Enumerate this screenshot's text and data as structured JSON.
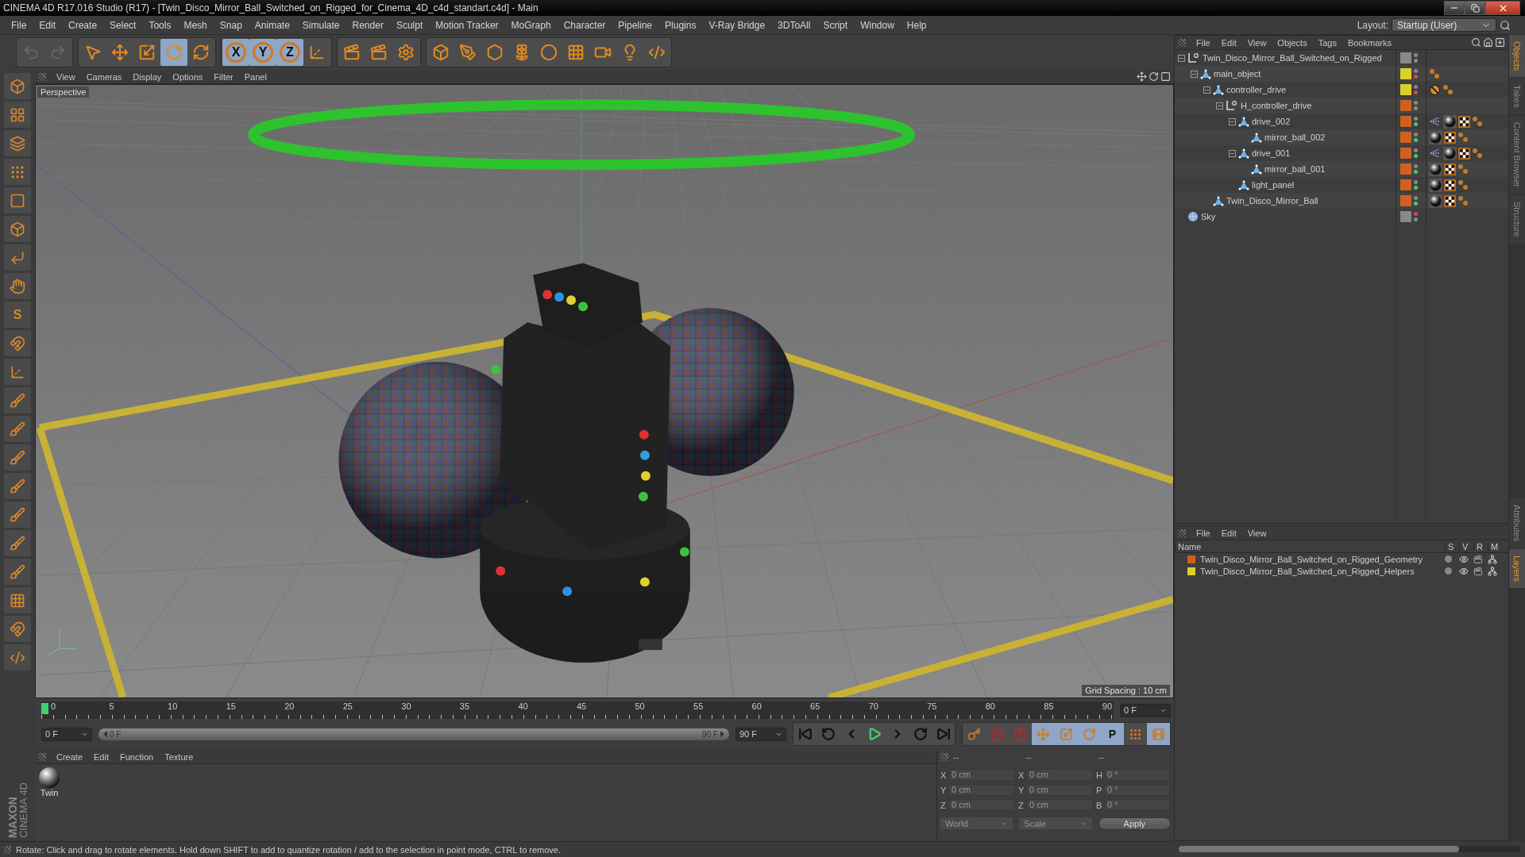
{
  "window": {
    "title": "CINEMA 4D R17.016 Studio (R17) - [Twin_Disco_Mirror_Ball_Switched_on_Rigged_for_Cinema_4D_c4d_standart.c4d] - Main"
  },
  "menu_bar": [
    "File",
    "Edit",
    "Create",
    "Select",
    "Tools",
    "Mesh",
    "Snap",
    "Animate",
    "Simulate",
    "Render",
    "Sculpt",
    "Motion Tracker",
    "MoGraph",
    "Character",
    "Pipeline",
    "Plugins",
    "V-Ray Bridge",
    "3DToAll",
    "Script",
    "Window",
    "Help"
  ],
  "layout": {
    "label": "Layout:",
    "value": "Startup (User)"
  },
  "toolbar": [
    {
      "kind": "undo",
      "selected": false,
      "disabled": true
    },
    {
      "kind": "redo",
      "selected": false,
      "disabled": true
    },
    {
      "kind": "select",
      "selected": false,
      "disabled": false
    },
    {
      "kind": "move",
      "selected": false,
      "disabled": false
    },
    {
      "kind": "scale",
      "selected": false,
      "disabled": false
    },
    {
      "kind": "rotate",
      "selected": true,
      "disabled": false
    },
    {
      "kind": "recent",
      "selected": false,
      "disabled": false
    },
    {
      "kind": "axis",
      "label": "X",
      "selected": true,
      "disabled": false
    },
    {
      "kind": "axis",
      "label": "Y",
      "selected": true,
      "disabled": false
    },
    {
      "kind": "axis",
      "label": "Z",
      "selected": true,
      "disabled": false
    },
    {
      "kind": "coords",
      "selected": false,
      "disabled": false
    },
    {
      "kind": "render",
      "selected": false,
      "disabled": false
    },
    {
      "kind": "render-view",
      "selected": false,
      "disabled": false
    },
    {
      "kind": "render-settings",
      "selected": false,
      "disabled": false
    },
    {
      "kind": "cube",
      "selected": false,
      "disabled": false
    },
    {
      "kind": "pen",
      "selected": false,
      "disabled": false
    },
    {
      "kind": "subdivide",
      "selected": false,
      "disabled": false
    },
    {
      "kind": "cloner",
      "selected": false,
      "disabled": false
    },
    {
      "kind": "deformer",
      "selected": false,
      "disabled": false
    },
    {
      "kind": "floor",
      "selected": false,
      "disabled": false
    },
    {
      "kind": "camera",
      "selected": false,
      "disabled": false
    },
    {
      "kind": "light",
      "selected": false,
      "disabled": false
    },
    {
      "kind": "python",
      "selected": false,
      "disabled": false
    }
  ],
  "left_tools": [
    {
      "kind": "cube",
      "selected": false
    },
    {
      "kind": "texture",
      "selected": false
    },
    {
      "kind": "layers",
      "selected": false
    },
    {
      "kind": "points",
      "selected": false
    },
    {
      "kind": "edges",
      "selected": false
    },
    {
      "kind": "polygons",
      "selected": false
    },
    {
      "kind": "angle",
      "selected": false
    },
    {
      "kind": "hand",
      "selected": false
    },
    {
      "kind": "letter",
      "label": "S",
      "selected": false
    },
    {
      "kind": "magnet",
      "selected": false
    },
    {
      "kind": "axis",
      "selected": false
    },
    {
      "kind": "brush",
      "selected": false
    },
    {
      "kind": "brush",
      "selected": false
    },
    {
      "kind": "brush",
      "selected": false
    },
    {
      "kind": "brush",
      "selected": false
    },
    {
      "kind": "brush",
      "selected": false
    },
    {
      "kind": "brush",
      "selected": false
    },
    {
      "kind": "brush",
      "selected": false
    },
    {
      "kind": "grid",
      "selected": false
    },
    {
      "kind": "magnet",
      "selected": false
    },
    {
      "kind": "python",
      "selected": false
    }
  ],
  "viewport": {
    "menu": [
      "View",
      "Cameras",
      "Display",
      "Options",
      "Filter",
      "Panel"
    ],
    "camera": "Perspective",
    "grid_spacing": "Grid Spacing : 10 cm"
  },
  "objects_panel": {
    "menu": [
      "File",
      "Edit",
      "View",
      "Objects",
      "Tags",
      "Bookmarks"
    ],
    "tree": [
      {
        "name": "Twin_Disco_Mirror_Ball_Switched_on_Rigged",
        "kind": "null",
        "color": "#888888",
        "editor_disabled": false,
        "render_enabled": false,
        "render_disabled": false,
        "expanded": true,
        "children": [
          {
            "name": "main_object",
            "kind": "polygon",
            "color": "#d9d02a",
            "editor_disabled": false,
            "render_enabled": false,
            "render_disabled": true,
            "tags": [
              {
                "kind": "dots"
              }
            ],
            "expanded": true,
            "children": [
              {
                "name": "controller_drive",
                "kind": "polygon",
                "color": "#d9d02a",
                "editor_disabled": false,
                "render_enabled": false,
                "render_disabled": true,
                "tags": [
                  {
                    "kind": "protection"
                  },
                  {
                    "kind": "dots"
                  }
                ],
                "expanded": true,
                "children": [
                  {
                    "name": "H_controller_drive",
                    "kind": "null",
                    "color": "#d06020",
                    "editor_disabled": false,
                    "render_enabled": false,
                    "render_disabled": false,
                    "expanded": true,
                    "children": [
                      {
                        "name": "drive_002",
                        "kind": "polygon",
                        "color": "#d06020",
                        "editor_disabled": false,
                        "render_enabled": true,
                        "render_disabled": false,
                        "tags": [
                          {
                            "kind": "ik"
                          },
                          {
                            "kind": "material"
                          },
                          {
                            "kind": "checker"
                          },
                          {
                            "kind": "dots"
                          }
                        ],
                        "expanded": true,
                        "children": [
                          {
                            "name": "mirror_ball_002",
                            "kind": "polygon",
                            "color": "#d06020",
                            "editor_disabled": false,
                            "render_enabled": true,
                            "render_disabled": false,
                            "tags": [
                              {
                                "kind": "material"
                              },
                              {
                                "kind": "checker"
                              },
                              {
                                "kind": "dots"
                              }
                            ]
                          }
                        ]
                      },
                      {
                        "name": "drive_001",
                        "kind": "polygon",
                        "color": "#d06020",
                        "editor_disabled": false,
                        "render_enabled": true,
                        "render_disabled": false,
                        "tags": [
                          {
                            "kind": "ik"
                          },
                          {
                            "kind": "material"
                          },
                          {
                            "kind": "checker"
                          },
                          {
                            "kind": "dots"
                          }
                        ],
                        "expanded": true,
                        "children": [
                          {
                            "name": "mirror_ball_001",
                            "kind": "polygon",
                            "color": "#d06020",
                            "editor_disabled": false,
                            "render_enabled": true,
                            "render_disabled": false,
                            "tags": [
                              {
                                "kind": "material"
                              },
                              {
                                "kind": "checker"
                              },
                              {
                                "kind": "dots"
                              }
                            ]
                          }
                        ]
                      },
                      {
                        "name": "light_panel",
                        "kind": "polygon",
                        "color": "#d06020",
                        "editor_disabled": false,
                        "render_enabled": true,
                        "render_disabled": false,
                        "tags": [
                          {
                            "kind": "material"
                          },
                          {
                            "kind": "checker"
                          },
                          {
                            "kind": "dots"
                          }
                        ]
                      }
                    ]
                  }
                ]
              },
              {
                "name": "Twin_Disco_Mirror_Ball",
                "kind": "polygon",
                "color": "#d06020",
                "editor_disabled": false,
                "render_enabled": true,
                "render_disabled": false,
                "tags": [
                  {
                    "kind": "material"
                  },
                  {
                    "kind": "checker"
                  },
                  {
                    "kind": "dots"
                  }
                ]
              }
            ]
          }
        ]
      },
      {
        "name": "Sky",
        "kind": "sky",
        "color": "#888888",
        "editor_disabled": true,
        "render_enabled": false,
        "render_disabled": false
      }
    ]
  },
  "side_tabs": [
    {
      "label": "Objects",
      "selected": true
    },
    {
      "label": "Takes",
      "selected": false
    },
    {
      "label": "Content Browser",
      "selected": false
    },
    {
      "label": "Structure",
      "selected": false
    }
  ],
  "layers_panel": {
    "menu": [
      "File",
      "Edit",
      "View"
    ],
    "columns": [
      "Name",
      "S",
      "V",
      "R",
      "M"
    ],
    "rows": [
      {
        "name": "Twin_Disco_Mirror_Ball_Switched_on_Rigged_Geometry",
        "color": "#d06020"
      },
      {
        "name": "Twin_Disco_Mirror_Ball_Switched_on_Rigged_Helpers",
        "color": "#d9d02a"
      }
    ]
  },
  "side_tabs_lower": [
    {
      "label": "Attributes",
      "selected": false
    },
    {
      "label": "Layers",
      "selected": true
    }
  ],
  "timeline": {
    "ticks": [
      "0",
      "5",
      "10",
      "15",
      "20",
      "25",
      "30",
      "35",
      "40",
      "45",
      "50",
      "55",
      "60",
      "65",
      "70",
      "75",
      "80",
      "85",
      "90"
    ],
    "level": 0,
    "current": "0 F",
    "start": "0 F",
    "range": {
      "start": "0 F",
      "end": "90 F",
      "level": 1
    },
    "end": "90 F",
    "buttons": [
      {
        "kind": "first"
      },
      {
        "kind": "prev-key"
      },
      {
        "kind": "prev"
      },
      {
        "kind": "play"
      },
      {
        "kind": "next"
      },
      {
        "kind": "next-key"
      },
      {
        "kind": "last"
      }
    ],
    "keys": [
      {
        "kind": "key",
        "selected": false
      },
      {
        "kind": "record",
        "selected": false
      },
      {
        "kind": "auto",
        "selected": false
      },
      {
        "kind": "move",
        "selected": true
      },
      {
        "kind": "scale",
        "selected": true
      },
      {
        "kind": "rotate",
        "selected": true
      },
      {
        "kind": "param",
        "label": "P",
        "selected": true
      },
      {
        "kind": "points",
        "selected": false
      },
      {
        "kind": "film",
        "selected": true
      }
    ]
  },
  "material_panel": {
    "menu": [
      "Create",
      "Edit",
      "Function",
      "Texture"
    ],
    "materials": [
      {
        "name": "Twin"
      }
    ]
  },
  "brand": [
    "MAXON",
    "CINEMA 4D"
  ],
  "coordinates": {
    "headers": [
      "--",
      "--",
      "--"
    ],
    "rows": [
      [
        {
          "axis": "X",
          "value": "0 cm"
        },
        {
          "axis": "X",
          "value": "0 cm"
        },
        {
          "axis": "H",
          "value": "0 °"
        }
      ],
      [
        {
          "axis": "Y",
          "value": "0 cm"
        },
        {
          "axis": "Y",
          "value": "0 cm"
        },
        {
          "axis": "P",
          "value": "0 °"
        }
      ],
      [
        {
          "axis": "Z",
          "value": "0 cm"
        },
        {
          "axis": "Z",
          "value": "0 cm"
        },
        {
          "axis": "B",
          "value": "0 °"
        }
      ]
    ],
    "mode": "World",
    "scale": "Scale",
    "apply": "Apply"
  },
  "status": "Rotate: Click and drag to rotate elements. Hold down SHIFT to add to quantize rotation / add to the selection in point mode, CTRL to remove."
}
